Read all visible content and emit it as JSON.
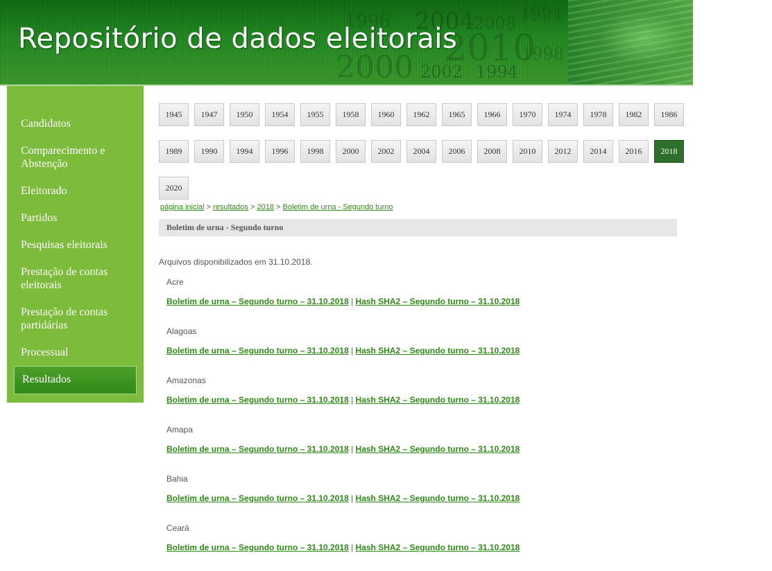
{
  "header": {
    "title": "Repositório de dados eleitorais",
    "decor_years": [
      "1996",
      "2004",
      "2008",
      "1994",
      "2010",
      "1998",
      "2000",
      "2002",
      "1994",
      "1996"
    ]
  },
  "sidebar": {
    "items": [
      {
        "label": "Candidatos"
      },
      {
        "label": "Comparecimento e Abstenção"
      },
      {
        "label": "Eleitorado"
      },
      {
        "label": "Partidos"
      },
      {
        "label": "Pesquisas eleitorais"
      },
      {
        "label": "Prestação de contas eleitorais"
      },
      {
        "label": "Prestação de contas partidárias"
      },
      {
        "label": "Processual"
      }
    ],
    "active_label": "Resultados"
  },
  "years": [
    "1945",
    "1947",
    "1950",
    "1954",
    "1955",
    "1958",
    "1960",
    "1962",
    "1965",
    "1966",
    "1970",
    "1974",
    "1978",
    "1982",
    "1986",
    "1989",
    "1990",
    "1994",
    "1996",
    "1998",
    "2000",
    "2002",
    "2004",
    "2006",
    "2008",
    "2010",
    "2012",
    "2014",
    "2016",
    "2018",
    "2020"
  ],
  "selected_year": "2018",
  "breadcrumb": {
    "items": [
      "página inicial",
      "resultados",
      "2018",
      "Boletim de urna - Segundo turno"
    ],
    "separator": ">"
  },
  "page_title": "Boletim de urna - Segundo turno",
  "intro": "Arquivos disponibilizados em 31.10.2018.",
  "link_separator": "|",
  "states": [
    {
      "name": "Acre",
      "link1": "Boletim de urna – Segundo turno – 31.10.2018",
      "link2": "Hash SHA2 – Segundo turno – 31.10.2018"
    },
    {
      "name": "Alagoas",
      "link1": "Boletim de urna – Segundo turno – 31.10.2018",
      "link2": "Hash SHA2 – Segundo turno – 31.10.2018"
    },
    {
      "name": "Amazonas",
      "link1": "Boletim de urna – Segundo turno – 31.10.2018",
      "link2": "Hash SHA2 – Segundo turno – 31.10.2018"
    },
    {
      "name": "Amapa",
      "link1": "Boletim de urna – Segundo turno – 31.10.2018",
      "link2": "Hash SHA2 – Segundo turno – 31.10.2018"
    },
    {
      "name": "Bahia",
      "link1": "Boletim de urna – Segundo turno – 31.10.2018",
      "link2": "Hash SHA2 – Segundo turno – 31.10.2018"
    },
    {
      "name": "Ceará",
      "link1": "Boletim de urna – Segundo turno – 31.10.2018",
      "link2": "Hash SHA2 – Segundo turno – 31.10.2018"
    }
  ],
  "colors": {
    "accent_green": "#2f8a17",
    "sidebar_bg": "#7dbb3c",
    "active_year_bg": "#2e6f2c"
  }
}
